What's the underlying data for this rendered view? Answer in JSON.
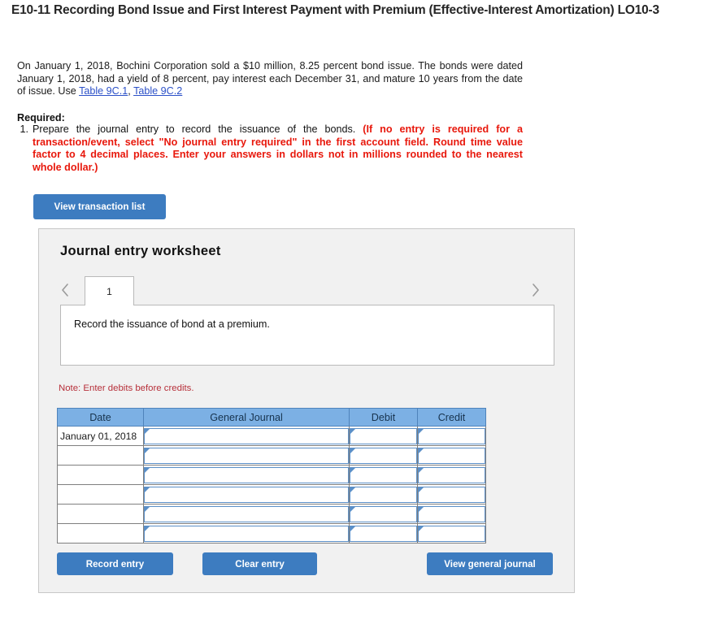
{
  "title": "E10-11 Recording Bond Issue and First Interest Payment with Premium (Effective-Interest Amortization) LO10-3",
  "problem": {
    "part1": "On January 1, 2018, Bochini Corporation sold a $10 million, 8.25 percent bond issue. The bonds were dated January 1, 2018, had a yield of 8 percent, pay interest each December 31, and mature 10 years from the date of issue. Use ",
    "link1": "Table 9C.1",
    "separator": ", ",
    "link2": "Table 9C.2"
  },
  "required": {
    "label": "Required:",
    "item_number": "1.",
    "item_text_black": "Prepare the journal entry to record the issuance of the bonds. ",
    "item_text_red": "(If no entry is required for a transaction/event, select \"No journal entry required\" in the first account field. Round time value factor to 4 decimal places. Enter your answers in dollars not in millions rounded to the nearest whole dollar.)"
  },
  "toolbar": {
    "view_transaction_list": "View transaction list"
  },
  "worksheet": {
    "heading": "Journal entry worksheet",
    "tabs": [
      {
        "label": "1",
        "active": true
      }
    ],
    "prev_icon": "chevron-left-icon",
    "next_icon": "chevron-right-icon",
    "description": "Record the issuance of bond at a premium.",
    "note": "Note: Enter debits before credits.",
    "table": {
      "headers": [
        "Date",
        "General Journal",
        "Debit",
        "Credit"
      ],
      "rows": [
        {
          "date": "January 01, 2018",
          "general_journal": "",
          "debit": "",
          "credit": ""
        },
        {
          "date": "",
          "general_journal": "",
          "debit": "",
          "credit": ""
        },
        {
          "date": "",
          "general_journal": "",
          "debit": "",
          "credit": ""
        },
        {
          "date": "",
          "general_journal": "",
          "debit": "",
          "credit": ""
        },
        {
          "date": "",
          "general_journal": "",
          "debit": "",
          "credit": ""
        },
        {
          "date": "",
          "general_journal": "",
          "debit": "",
          "credit": ""
        }
      ]
    },
    "buttons": {
      "record_entry": "Record entry",
      "clear_entry": "Clear entry",
      "view_general_journal": "View general journal"
    }
  },
  "colors": {
    "button_blue": "#3d7cc0",
    "header_blue": "#7cb0e4",
    "link_blue": "#2b50c8",
    "required_red": "#e8180c",
    "note_red": "#b7303a",
    "card_bg": "#f1f1f1"
  }
}
